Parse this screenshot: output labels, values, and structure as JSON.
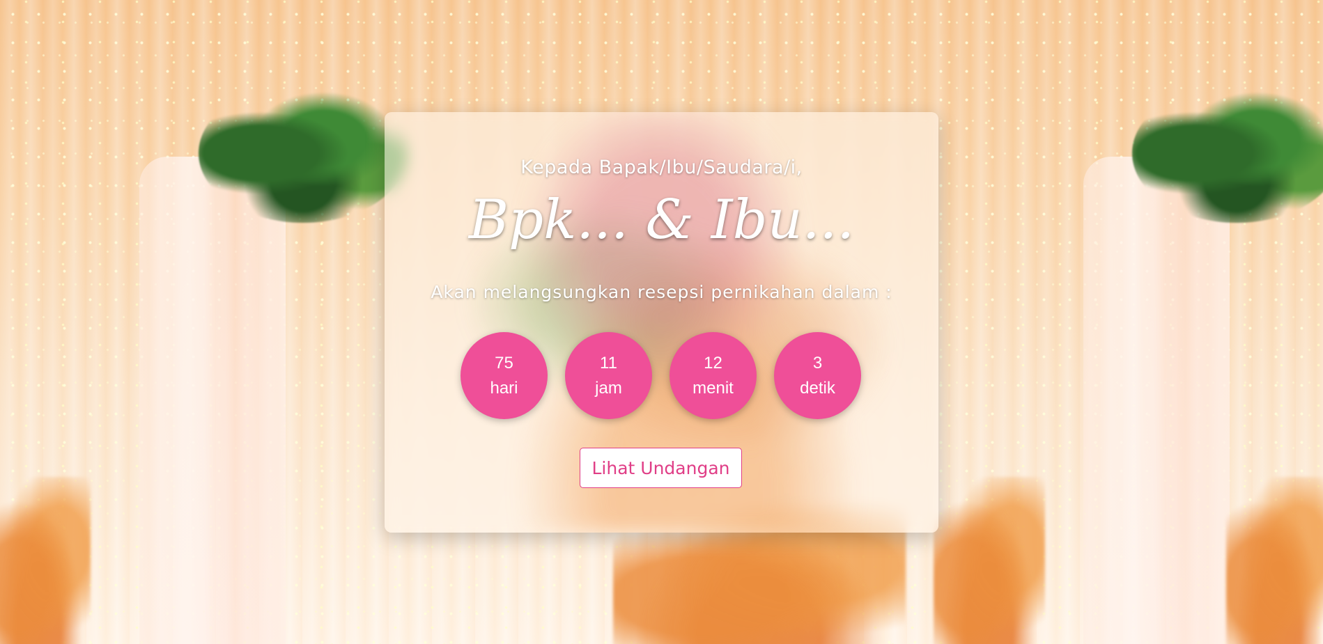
{
  "invitation": {
    "greeting": "Kepada Bapak/Ibu/Saudara/i,",
    "guest_name": "Bpk... & Ibu...",
    "subtitle": "Akan melangsungkan resepsi pernikahan dalam :"
  },
  "countdown": {
    "accent_color": "#ef4f98",
    "items": [
      {
        "value": "75",
        "unit": "hari"
      },
      {
        "value": "11",
        "unit": "jam"
      },
      {
        "value": "12",
        "unit": "menit"
      },
      {
        "value": "3",
        "unit": "detik"
      }
    ]
  },
  "cta": {
    "label": "Lihat Undangan"
  }
}
